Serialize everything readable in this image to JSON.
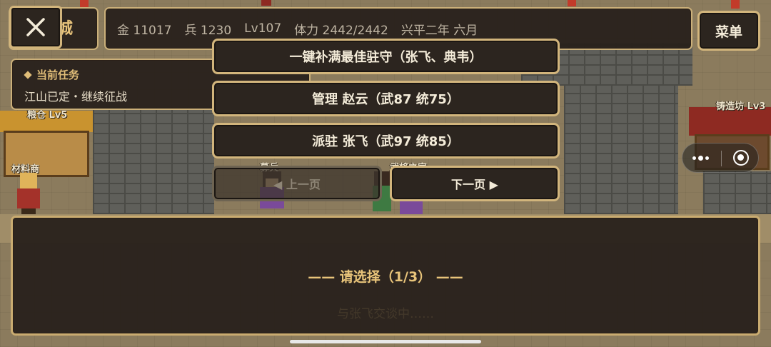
{
  "topbar": {
    "city_name_partial": "城",
    "stats": [
      "金 11017",
      "兵 1230",
      "Lv107",
      "体力 2442/2442",
      "兴平二年 六月"
    ],
    "menu_label": "菜单"
  },
  "task": {
    "heading": "当前任务",
    "text": "江山已定・继续征战"
  },
  "map_labels": {
    "grain_shop": "粮仓 Lv5",
    "material_merchant": "材料商",
    "forge": "铸造坊 Lv3",
    "recruit": "募兵",
    "officer": "武将之家"
  },
  "menu": {
    "options": [
      "一键补满最佳驻守（张飞、典韦）",
      "管理 赵云（武87 统75）",
      "派驻 张飞（武97 统85）"
    ],
    "prev_label": "◀ 上一页",
    "next_label": "下一页 ▶"
  },
  "dialog": {
    "title": "—— 请选择（1/3） ——",
    "faded_text": "与张飞交谈中……"
  },
  "colors": {
    "panel_bg": "#28211b",
    "gold_border": "#d2b57c",
    "title_gold": "#e8c47a",
    "text_light": "#f4ecd9"
  }
}
